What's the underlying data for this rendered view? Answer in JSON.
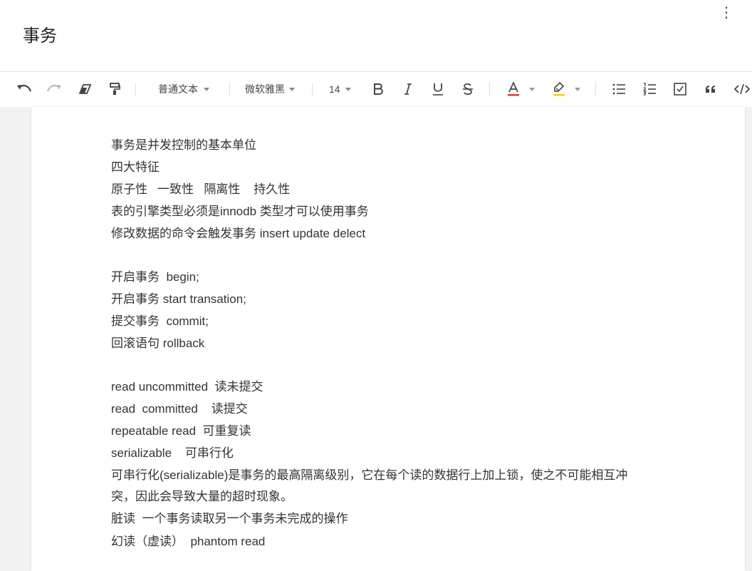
{
  "document": {
    "title": "事务"
  },
  "toolbar": {
    "paragraph_style": "普通文本",
    "font_family": "微软雅黑",
    "font_size": "14",
    "icons": [
      "undo-icon",
      "redo-icon",
      "eraser-icon",
      "format-painter-icon",
      "bold-icon",
      "italic-icon",
      "underline-icon",
      "strikethrough-icon",
      "font-color-icon",
      "highlight-icon",
      "bullet-list-icon",
      "numbered-list-icon",
      "checklist-icon",
      "quote-icon",
      "code-icon"
    ],
    "colors": {
      "font_color_bar": "#e53935",
      "highlight_bar": "#f5d000"
    }
  },
  "content": {
    "lines": [
      "事务是并发控制的基本单位",
      "四大特征",
      "原子性   一致性   隔离性    持久性",
      "表的引擎类型必须是innodb 类型才可以使用事务",
      "修改数据的命令会触发事务 insert update delect",
      "",
      "开启事务  begin;",
      "开启事务 start transation;",
      "提交事务  commit;",
      "回滚语句 rollback",
      "",
      "read uncommitted  读未提交",
      "read  committed    读提交",
      "repeatable read  可重复读",
      "serializable    可串行化",
      "可串行化(serializable)是事务的最高隔离级别，它在每个读的数据行上加上锁，使之不可能相互冲",
      "突，因此会导致大量的超时现象。",
      "脏读  一个事务读取另一个事务未完成的操作",
      "幻读（虚读）  phantom read"
    ]
  }
}
